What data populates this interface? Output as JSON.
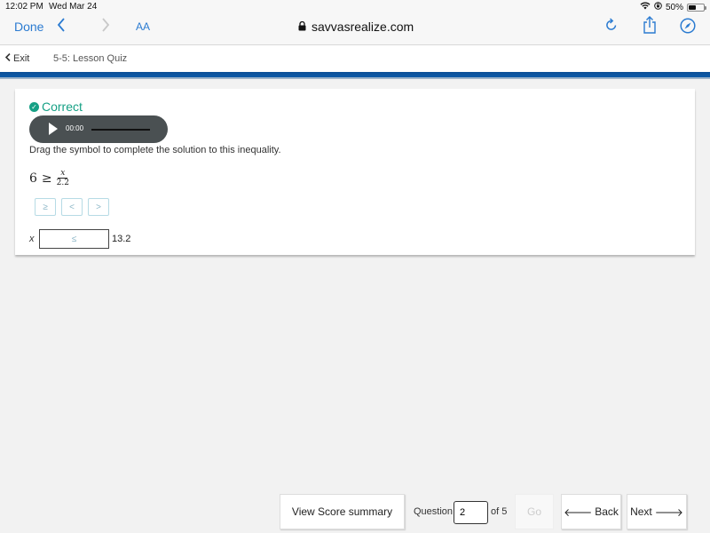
{
  "status_bar": {
    "time": "12:02 PM",
    "date": "Wed Mar 24",
    "battery": "50%",
    "battery_level": 0.5
  },
  "browser": {
    "done_label": "Done",
    "text_size_label": "AA",
    "url": "savvasrealize.com",
    "icons": [
      "back-chevron",
      "forward-chevron",
      "lock",
      "reload",
      "share",
      "compass"
    ]
  },
  "lesson": {
    "exit_label": "Exit",
    "title": "5-5: Lesson Quiz"
  },
  "question": {
    "status": "Correct",
    "accent_color": "#16a085",
    "audio_time": "00:00",
    "prompt": "Drag the symbol to complete the solution to this inequality.",
    "equation": {
      "lhs": "6",
      "operator": "≥",
      "numerator": "x",
      "denominator": "2.2"
    },
    "symbol_tiles": [
      "≥",
      "<",
      ">"
    ],
    "answer": {
      "variable": "x",
      "placed_symbol": "≤",
      "value": "13.2"
    }
  },
  "footer": {
    "score_summary_label": "View Score summary",
    "question_label": "Question",
    "question_number": "2",
    "of_label": "of 5",
    "go_label": "Go",
    "back_label": "Back",
    "next_label": "Next"
  }
}
